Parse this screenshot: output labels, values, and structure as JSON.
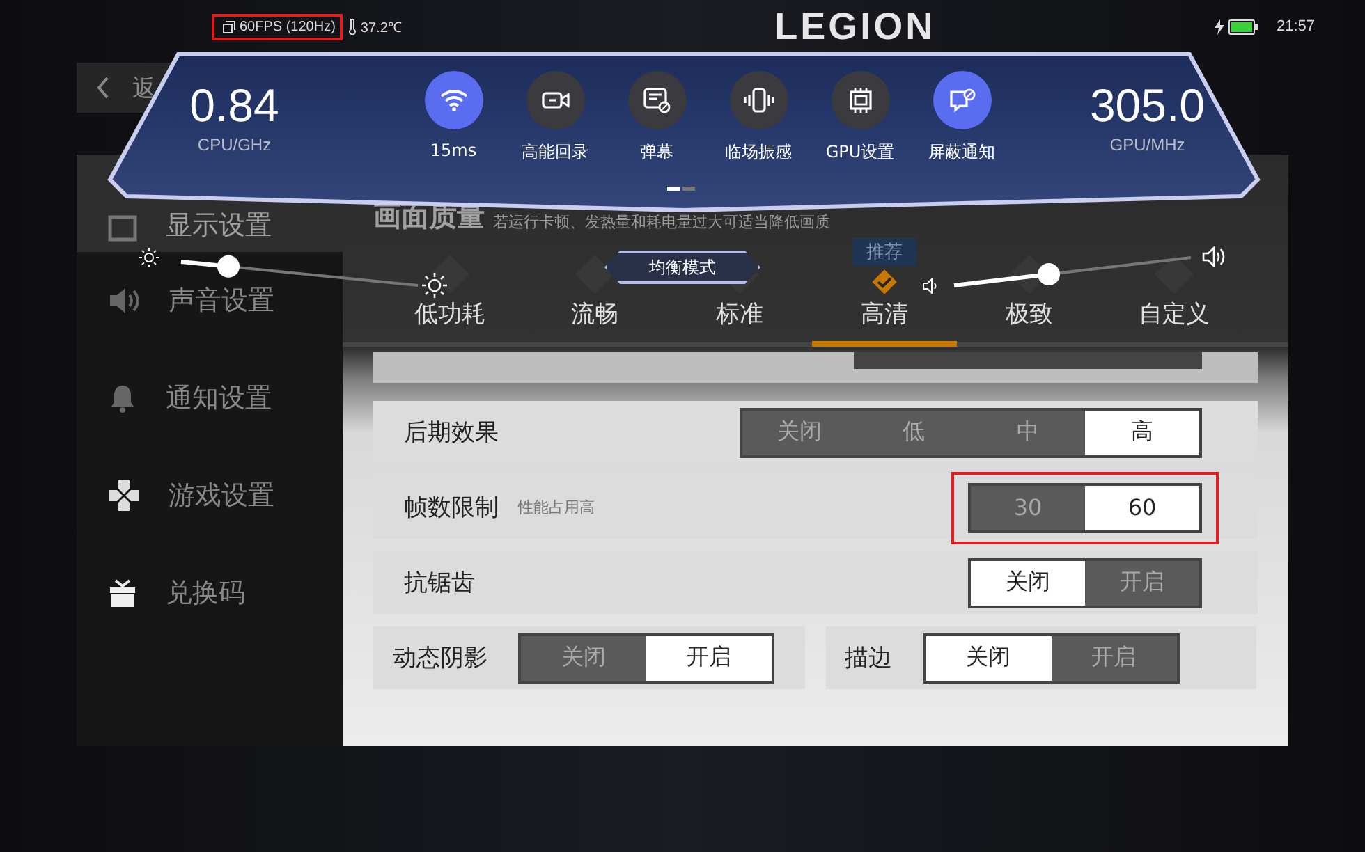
{
  "status_bar": {
    "fps": "60FPS (120Hz)",
    "fps_highlighted": true,
    "temperature": "37.2℃",
    "logo": "LEGION",
    "charging": true,
    "time": "21:57"
  },
  "header": {
    "back": "返"
  },
  "sidebar": {
    "items": [
      {
        "label": "显示设置",
        "kind": "display",
        "selected": true
      },
      {
        "label": "声音设置",
        "kind": "sound",
        "selected": false
      },
      {
        "label": "通知设置",
        "kind": "bell",
        "selected": false
      },
      {
        "label": "游戏设置",
        "kind": "gamepad",
        "selected": false
      },
      {
        "label": "兑换码",
        "kind": "gift",
        "selected": false
      }
    ]
  },
  "section": {
    "title": "画面质量",
    "hint": "若运行卡顿、发热量和耗电量过大可适当降低画质"
  },
  "presets": [
    {
      "label": "低功耗",
      "selected": false
    },
    {
      "label": "流畅",
      "selected": false
    },
    {
      "label": "标准",
      "selected": false
    },
    {
      "label": "高清",
      "selected": true,
      "badge": "推荐"
    },
    {
      "label": "极致",
      "selected": false
    },
    {
      "label": "自定义",
      "selected": false
    }
  ],
  "settings": [
    {
      "kind": "full",
      "label": "后期效果",
      "highlighted": false,
      "options": [
        {
          "label": "关闭",
          "selected": false
        },
        {
          "label": "低",
          "selected": false
        },
        {
          "label": "中",
          "selected": false
        },
        {
          "label": "高",
          "selected": true
        }
      ]
    },
    {
      "kind": "full",
      "label": "帧数限制",
      "note": "性能占用高",
      "highlighted": true,
      "options": [
        {
          "label": "30",
          "selected": false
        },
        {
          "label": "60",
          "selected": true
        }
      ]
    },
    {
      "kind": "full",
      "label": "抗锯齿",
      "highlighted": false,
      "options": [
        {
          "label": "关闭",
          "selected": true
        },
        {
          "label": "开启",
          "selected": false
        }
      ]
    },
    {
      "kind": "half",
      "label": "动态阴影",
      "highlighted": false,
      "options": [
        {
          "label": "关闭",
          "selected": false
        },
        {
          "label": "开启",
          "selected": true
        }
      ]
    },
    {
      "kind": "half",
      "label": "描边",
      "highlighted": false,
      "options": [
        {
          "label": "关闭",
          "selected": true
        },
        {
          "label": "开启",
          "selected": false
        }
      ]
    }
  ],
  "overlay": {
    "cpu": {
      "value": "0.84",
      "unit": "CPU/GHz"
    },
    "gpu": {
      "value": "305.0",
      "unit": "GPU/MHz"
    },
    "tools": [
      {
        "label": "15ms",
        "kind": "wifi",
        "on": true
      },
      {
        "label": "高能回录",
        "kind": "record",
        "on": false
      },
      {
        "label": "弹幕",
        "kind": "danmaku",
        "on": false
      },
      {
        "label": "临场振感",
        "kind": "vibrate",
        "on": false
      },
      {
        "label": "GPU设置",
        "kind": "chip",
        "on": false
      },
      {
        "label": "屏蔽通知",
        "kind": "blocknotify",
        "on": true
      }
    ],
    "mode": "均衡模式",
    "brightness": {
      "level": 0.2
    },
    "volume": {
      "level": 0.4
    }
  }
}
